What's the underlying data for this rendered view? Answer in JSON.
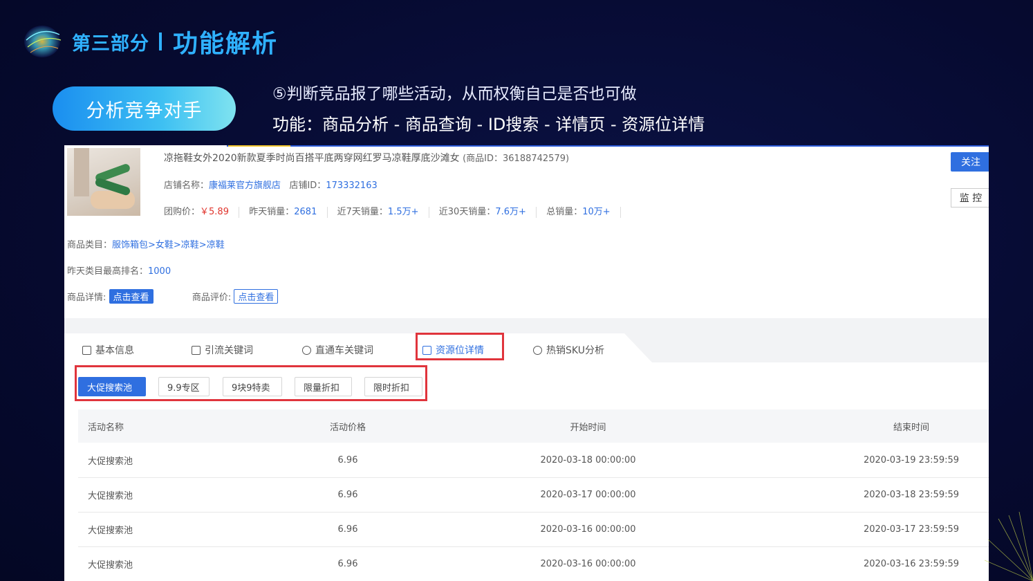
{
  "slide": {
    "part_label": "第三部分",
    "title": "功能解析",
    "pill_label": "分析竞争对手",
    "desc_line1": "⑤判断竞品报了哪些活动，从而权衡自己是否也可做",
    "desc_line2": "功能：商品分析 - 商品查询 - ID搜索 - 详情页 - 资源位详情"
  },
  "product": {
    "title": "凉拖鞋女外2020新款夏季时尚百搭平底两穿网红罗马凉鞋厚底沙滩女",
    "id_text": "(商品ID：36188742579)",
    "shop_label": "店铺名称：",
    "shop_name": "康福莱官方旗舰店",
    "shop_id_label": "店铺ID：",
    "shop_id": "173332163",
    "group_price_label": "团购价：",
    "group_price": "￥5.89",
    "yesterday_sales_label": "昨天销量：",
    "yesterday_sales": "2681",
    "sales_7d_label": "近7天销量：",
    "sales_7d": "1.5万+",
    "sales_30d_label": "近30天销量：",
    "sales_30d": "7.6万+",
    "total_sales_label": "总销量：",
    "total_sales": "10万+",
    "category_label": "商品类目：",
    "category": "服饰箱包>女鞋>凉鞋>凉鞋",
    "rank_label": "昨天类目最高排名：",
    "rank": "1000",
    "detail_label": "商品详情:",
    "detail_btn": "点击查看",
    "review_label": "商品评价:",
    "review_btn": "点击查看",
    "follow_btn": "关注",
    "monitor_btn": "监 控"
  },
  "tabs": [
    {
      "label": "基本信息",
      "icon": "document-icon"
    },
    {
      "label": "引流关键词",
      "icon": "search-doc-icon"
    },
    {
      "label": "直通车关键词",
      "icon": "pen-icon"
    },
    {
      "label": "资源位详情",
      "icon": "calendar-icon",
      "active": true
    },
    {
      "label": "热销SKU分析",
      "icon": "timer-icon"
    }
  ],
  "sub_tabs": [
    {
      "label": "大促搜索池",
      "active": true
    },
    {
      "label": "9.9专区"
    },
    {
      "label": "9块9特卖"
    },
    {
      "label": "限量折扣"
    },
    {
      "label": "限时折扣"
    }
  ],
  "table": {
    "headers": [
      "活动名称",
      "活动价格",
      "开始时间",
      "结束时间"
    ],
    "rows": [
      [
        "大促搜索池",
        "6.96",
        "2020-03-18 00:00:00",
        "2020-03-19 23:59:59"
      ],
      [
        "大促搜索池",
        "6.96",
        "2020-03-17 00:00:00",
        "2020-03-18 23:59:59"
      ],
      [
        "大促搜索池",
        "6.96",
        "2020-03-16 00:00:00",
        "2020-03-17 23:59:59"
      ],
      [
        "大促搜索池",
        "6.96",
        "2020-03-16 00:00:00",
        "2020-03-16 23:59:59"
      ]
    ]
  },
  "colors": {
    "accent": "#2f6fe0",
    "title": "#2fb1ff",
    "highlight_box": "#e0343c",
    "background": "#060a30"
  }
}
